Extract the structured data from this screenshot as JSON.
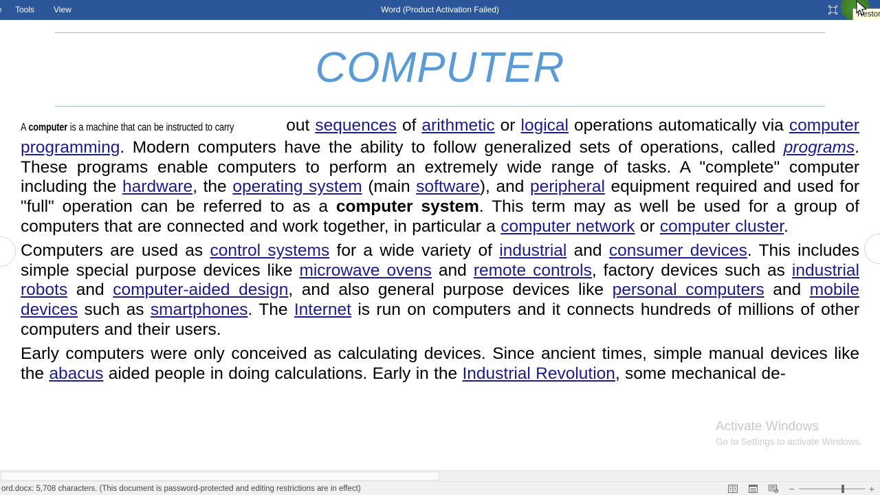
{
  "titlebar": {
    "menu_items": [
      {
        "label": "e",
        "truncated": true
      },
      {
        "label": "Tools"
      },
      {
        "label": "View"
      }
    ],
    "title": "Word (Product Activation Failed)",
    "restore_icon": "restore-icon",
    "minimize_icon": "minimize-icon",
    "tooltip": "Restore",
    "bg_color": "#2b579a"
  },
  "document": {
    "title": "COMPUTER",
    "title_color": "#5b9bd5",
    "lead_small": {
      "before_bold": "A ",
      "bold": "computer",
      "after_bold": " is a machine that can be instructed to carry"
    },
    "paragraph1": {
      "t1": " out ",
      "l1": "sequences",
      "t2": " of ",
      "l2": "arithmetic",
      "t3": " or ",
      "l3": "logical",
      "t4": " operations automatically via ",
      "l4": "computer programming",
      "t5": ". Modern computers have the ability to follow generalized sets of operations, called ",
      "l5": "programs",
      "t6": ". These programs enable computers to perform an extremely wide range of tasks. A \"complete\" computer including the ",
      "l6": "hardware",
      "t7": ", the ",
      "l7": "operating system",
      "t8": " (main ",
      "l8": "software",
      "t9": "), and ",
      "l9": "peripheral",
      "t10": " equipment required and used for \"full\" operation can be referred to as a ",
      "b1": "computer system",
      "t11": ". This term may as well be used for a group of computers that are connected and work together, in particular a ",
      "l10": "computer network",
      "t12": " or ",
      "l11": "computer cluster",
      "t13": "."
    },
    "paragraph2": {
      "t1": "Computers are used as ",
      "l1": "control systems",
      "t2": " for a wide variety of ",
      "l2": "industrial",
      "t3": " and ",
      "l3": "consumer devices",
      "t4": ". This includes simple special purpose devices like ",
      "l4": "microwave ovens",
      "t5": " and ",
      "l5": "remote controls",
      "t6": ", factory devices such as ",
      "l6": "industrial robots",
      "t7": " and ",
      "l7": "computer-aided design",
      "t8": ", and also general purpose devices like ",
      "l8": "personal computers",
      "t9": " and ",
      "l9": "mobile devices",
      "t10": " such as ",
      "l10": "smartphones",
      "t11": ". The ",
      "l11": "Internet",
      "t12": " is run on computers and it connects hundreds of millions of other computers and their users."
    },
    "paragraph3": {
      "t1": "Early computers were only conceived as calculating devices. Since ancient times, simple manual devices like the ",
      "l1": "abacus",
      "t2": " aided people in doing calculations. Early in the ",
      "l2": "Industrial Revolution",
      "t3": ", some mechanical de-"
    },
    "link_color": "#1b1b8f"
  },
  "watermark": {
    "title": "Activate Windows",
    "subtitle": "Go to Settings to activate Windows."
  },
  "statusbar": {
    "text": "ord.docx: 5,708 characters.  (This document is password-protected and editing restrictions are in effect)",
    "view_icons": [
      "read-mode-icon",
      "print-layout-icon",
      "web-layout-icon"
    ],
    "zoom_minus": "−",
    "zoom_plus": "+"
  }
}
